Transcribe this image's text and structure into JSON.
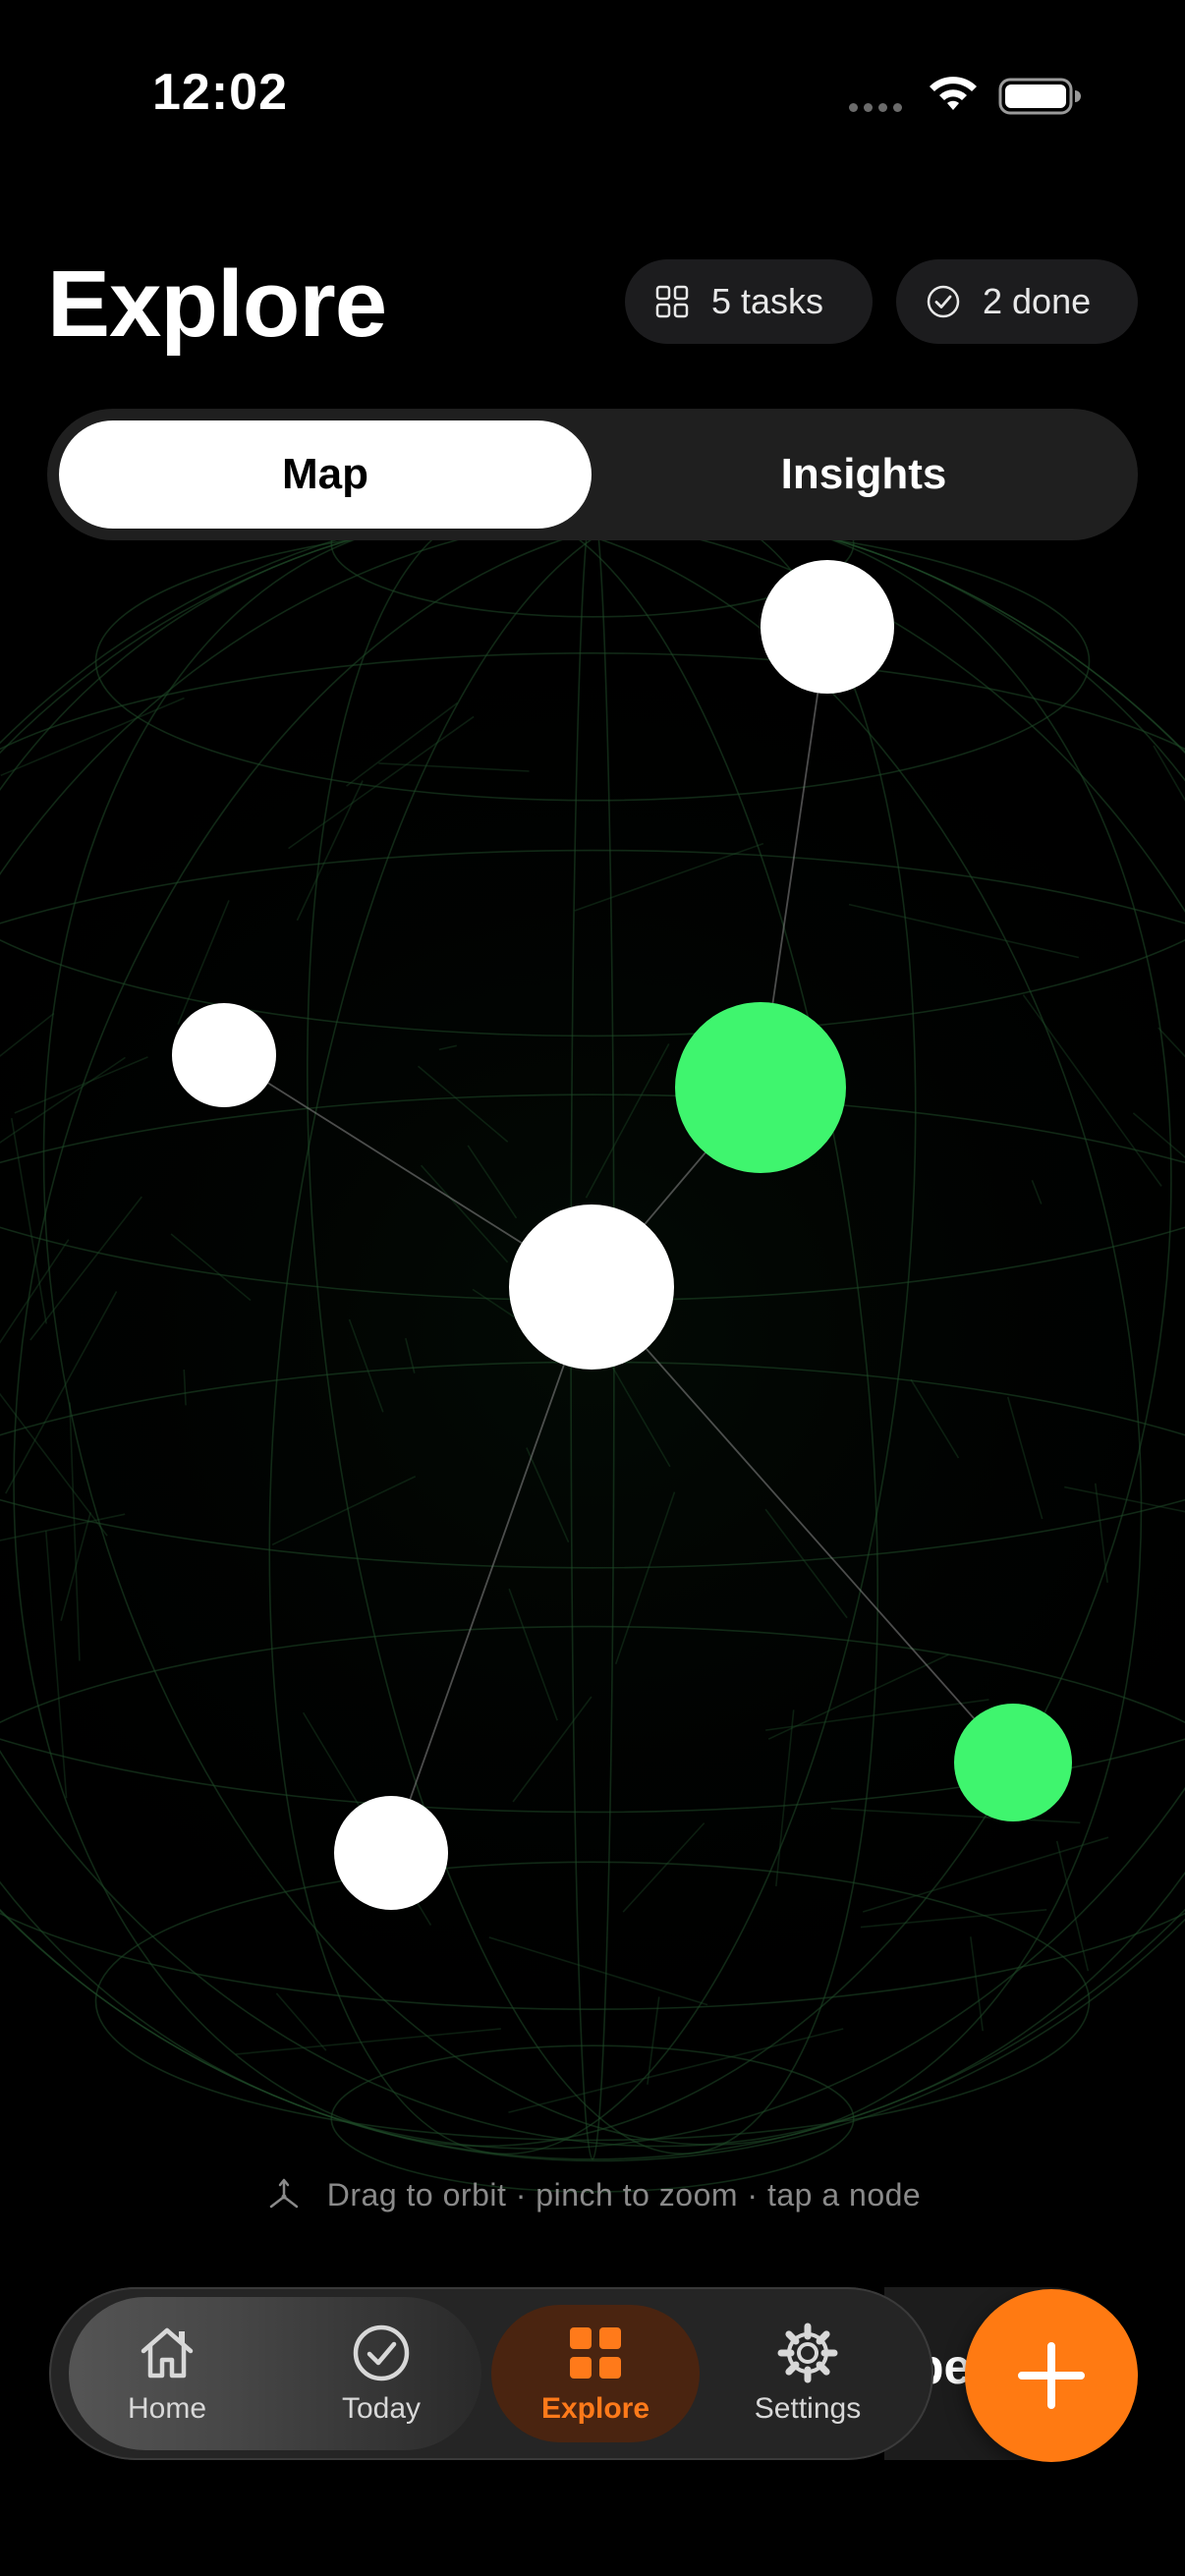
{
  "status_bar": {
    "time": "12:02",
    "icons": [
      "cellular-dots-icon",
      "wifi-icon",
      "battery-icon"
    ]
  },
  "header": {
    "title": "Explore",
    "tasks_badge": "5 tasks",
    "done_badge": "2 done"
  },
  "segmented": {
    "items": [
      {
        "label": "Map",
        "selected": true
      },
      {
        "label": "Insights",
        "selected": false
      }
    ]
  },
  "graph": {
    "nodes": [
      {
        "id": "n1",
        "color": "#ffffff"
      },
      {
        "id": "n2",
        "color": "#ffffff"
      },
      {
        "id": "n3",
        "color": "#3ff56e"
      },
      {
        "id": "n4",
        "color": "#ffffff"
      },
      {
        "id": "n5",
        "color": "#3ff56e"
      },
      {
        "id": "n6",
        "color": "#ffffff"
      }
    ],
    "edges": [
      [
        "n1",
        "n3"
      ],
      [
        "n3",
        "n4"
      ],
      [
        "n2",
        "n4"
      ],
      [
        "n4",
        "n6"
      ],
      [
        "n4",
        "n5"
      ]
    ]
  },
  "hint": {
    "text": "Drag to orbit · pinch to zoom · tap a node"
  },
  "tabbar": {
    "items": [
      {
        "label": "Home",
        "icon": "house-icon",
        "selected": false
      },
      {
        "label": "Today",
        "icon": "checkmark-circle-icon",
        "selected": false
      },
      {
        "label": "Explore",
        "icon": "grid-icon",
        "selected": true
      },
      {
        "label": "Settings",
        "icon": "gear-icon",
        "selected": false
      }
    ]
  },
  "peek_text": "pe",
  "fab": {
    "icon": "plus-icon"
  },
  "colors": {
    "accent": "#ff7a12",
    "node_green": "#3ff56e",
    "background": "#000000"
  }
}
